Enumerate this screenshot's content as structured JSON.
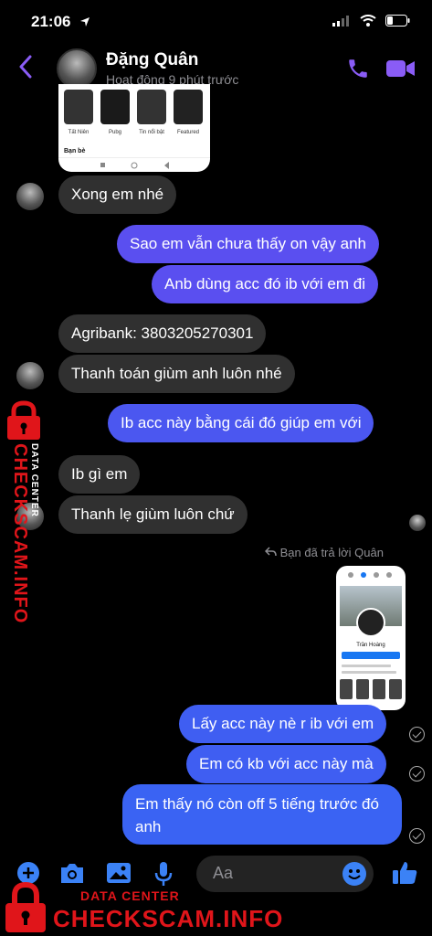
{
  "status_bar": {
    "time": "21:06"
  },
  "header": {
    "contact_name": "Đặng Quân",
    "contact_status": "Hoạt động 9 phút trước"
  },
  "shared_image": {
    "labels": [
      "Tất Niên",
      "Pubg",
      "Tin nổi bật",
      "Featured"
    ],
    "footer": "Bạn bè"
  },
  "messages": [
    {
      "dir": "in",
      "text": "Xong em nhé"
    },
    {
      "dir": "out",
      "text": "Sao em vẫn chưa thấy on vậy anh"
    },
    {
      "dir": "out",
      "text": "Anb dùng acc đó ib với em đi"
    },
    {
      "dir": "in",
      "text": "Agribank: 3803205270301"
    },
    {
      "dir": "in",
      "text": "Thanh toán giùm anh luôn nhé"
    },
    {
      "dir": "out",
      "text": "Ib acc này bằng cái đó giúp em với"
    },
    {
      "dir": "in",
      "text": "Ib gì em"
    },
    {
      "dir": "in",
      "text": "Thanh lẹ giùm luôn chứ"
    },
    {
      "dir": "out",
      "text": "Lấy acc này nè r ib với em"
    },
    {
      "dir": "out",
      "text": "Em có kb với acc này mà"
    },
    {
      "dir": "out",
      "text": "Em thấy nó còn off 5 tiếng trước đó anh"
    }
  ],
  "reply_note": "Bạn đã trả lời Quân",
  "phone_preview": {
    "name": "Trần Hoàng"
  },
  "composer": {
    "placeholder": "Aa"
  },
  "watermark": {
    "data_center": "DATA CENTER",
    "site": "CHECKSCAM.INFO"
  },
  "colors": {
    "outgoing_top": "#5a4ff0",
    "outgoing_bottom": "#3a63f3",
    "incoming": "#303030",
    "accent": "#8a5cf6",
    "watermark_red": "#e0151a"
  }
}
